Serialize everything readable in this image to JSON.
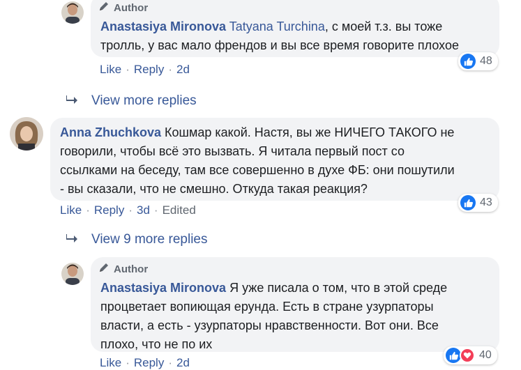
{
  "comments": [
    {
      "id": "c1",
      "badge": "Author",
      "name": "Anastasiya Mironova",
      "mention": "Tatyana Turchina",
      "line1": ", с моей т.з. вы тоже",
      "line2": "тролль, у вас мало френдов и вы все время говорите плохое",
      "like": "Like",
      "reply": "Reply",
      "time": "2d",
      "reactions": "48"
    },
    {
      "id": "c2",
      "name": "Anna Zhuchkova",
      "line1": "Кошмар какой. Настя, вы же НИЧЕГО ТАКОГО не",
      "line2": "говорили, чтобы всё это вызвать. Я читала первый пост со",
      "line3": "ссылками на беседу, там все совершенно в духе ФБ: они пошутили",
      "line4": "- вы сказали, что не смешно. Откуда такая реакция?",
      "like": "Like",
      "reply": "Reply",
      "time": "3d",
      "edited": "Edited",
      "reactions": "43"
    },
    {
      "id": "c3",
      "badge": "Author",
      "name": "Anastasiya Mironova",
      "line1": "Я уже писала о том, что в этой среде",
      "line2": "процветает вопиющая ерунда. Есть в стране узурпаторы",
      "line3": "власти, а есть - узурпаторы нравственности. Вот они. Все",
      "line4": "плохо, что не по их",
      "like": "Like",
      "reply": "Reply",
      "time": "2d",
      "reactions": "40"
    }
  ],
  "view_more_1": "View more replies",
  "view_more_2": "View 9 more replies",
  "colors": {
    "link": "#385898",
    "bubble": "#f2f3f5",
    "like": "#1877f2",
    "love": "#f33e58"
  }
}
